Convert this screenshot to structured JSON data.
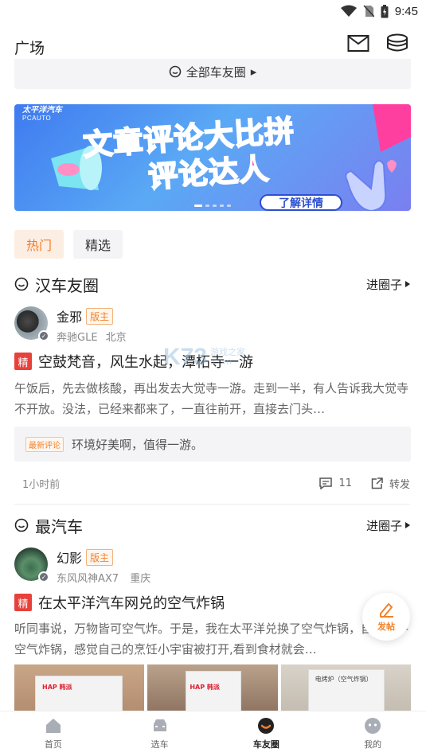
{
  "status_bar": {
    "time": "9:45"
  },
  "header": {
    "title": "广场"
  },
  "all_circles": {
    "label": "全部车友圈",
    "arrow": "▸"
  },
  "banner": {
    "logo_brand": "太平洋汽车",
    "logo_sub": "PCAUTO",
    "headline": "文章评论大比拼",
    "subhead": "评论达人",
    "cta": "了解详情"
  },
  "filter_tabs": [
    {
      "label": "热门",
      "active": true
    },
    {
      "label": "精选",
      "active": false
    }
  ],
  "sections": [
    {
      "circle_name": "汉车友圈",
      "enter_label": "进圈子",
      "author": {
        "name": "金邪",
        "badge": "版主",
        "car": "奔驰GLE",
        "city": "北京"
      },
      "post": {
        "tag": "精",
        "title": "空鼓梵音，风生水起，潭柘寺一游",
        "body": "午饭后，先去做核酸，再出发去大觉寺一游。走到一半，有人告诉我大觉寺不开放。没法，已经来都来了，一直往前开，直接去门头…"
      },
      "latest_comment": {
        "tag": "最新评论",
        "text": "环境好美啊，值得一游。"
      },
      "footer": {
        "time": "1小时前",
        "comments": "11",
        "share_label": "转发"
      }
    },
    {
      "circle_name": "最汽车",
      "enter_label": "进圈子",
      "author": {
        "name": "幻影",
        "badge": "版主",
        "car": "东风风神AX7",
        "city": "重庆"
      },
      "post": {
        "tag": "精",
        "title": "在太平洋汽车网兑的空气炸锅",
        "body": "听同事说，万物皆可空气炸。于是，我在太平洋兑换了空气炸锅，自从入手空气炸锅，感觉自己的烹饪小宇宙被打开,看到食材就会…"
      },
      "images": [
        {
          "label": "HAP 韩派"
        },
        {
          "label": "HAP 韩派"
        },
        {
          "label": "电烤炉（空气炸锅）"
        }
      ]
    }
  ],
  "watermark": {
    "logo": "K73",
    "line1": "游戏之家",
    "line2": ".com"
  },
  "fab": {
    "label": "发帖"
  },
  "tabbar": [
    {
      "label": "首页",
      "icon": "home-icon",
      "active": false
    },
    {
      "label": "选车",
      "icon": "car-icon",
      "active": false
    },
    {
      "label": "车友圈",
      "icon": "circle-smile-icon",
      "active": true
    },
    {
      "label": "我的",
      "icon": "profile-icon",
      "active": false
    }
  ],
  "colors": {
    "accent": "#f57c2a",
    "accent_bg": "#fdeee3",
    "jing_red": "#e8403a",
    "banner_blue": "#3f7af0",
    "banner_pink": "#ff4fa8"
  }
}
